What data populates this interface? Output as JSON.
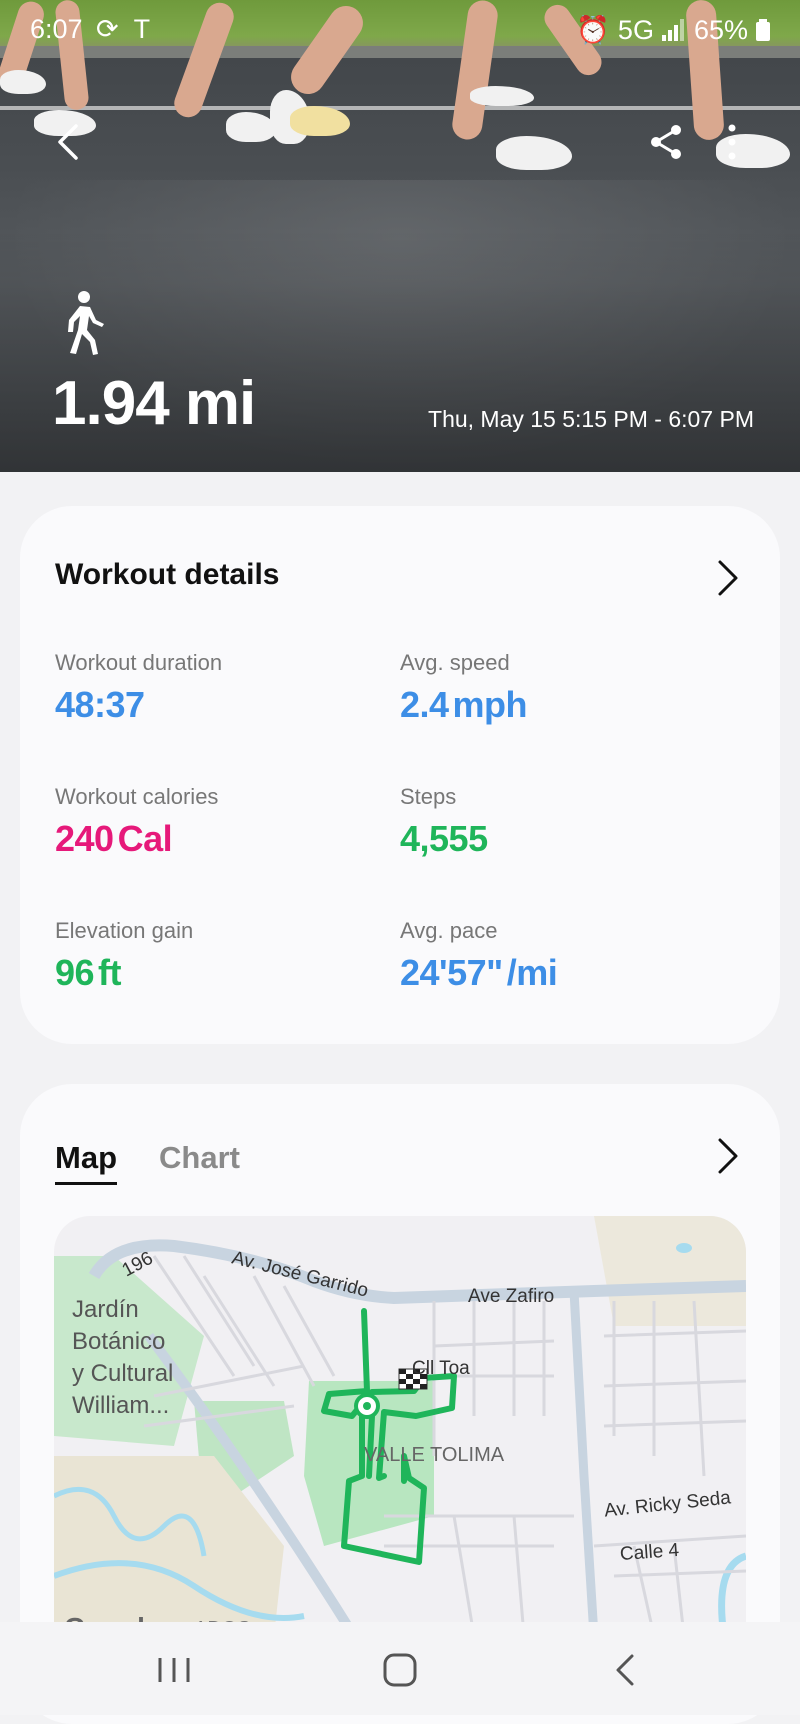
{
  "status": {
    "time": "6:07",
    "network": "5G",
    "battery": "65%"
  },
  "hero": {
    "activity_icon": "walk-icon",
    "distance": "1.94 mi",
    "date_range": "Thu, May 15 5:15 PM - 6:07 PM"
  },
  "details": {
    "title": "Workout details",
    "metrics": [
      {
        "label": "Workout duration",
        "value": "48:37",
        "unit": "",
        "color": "#3d8ee6"
      },
      {
        "label": "Avg. speed",
        "value": "2.4",
        "unit": "mph",
        "color": "#3d8ee6"
      },
      {
        "label": "Workout calories",
        "value": "240",
        "unit": "Cal",
        "color": "#e6197a"
      },
      {
        "label": "Steps",
        "value": "4,555",
        "unit": "",
        "color": "#1fb55a"
      },
      {
        "label": "Elevation gain",
        "value": "96",
        "unit": "ft",
        "color": "#1fb55a"
      },
      {
        "label": "Avg. pace",
        "value": "24'57\"",
        "unit": "/mi",
        "color": "#3d8ee6"
      }
    ]
  },
  "map_card": {
    "tabs": [
      "Map",
      "Chart"
    ],
    "active_tab": "Map",
    "labels": {
      "road_196": "196",
      "jose_garrido": "Av. José Garrido",
      "zafiro": "Ave Zafiro",
      "toa": "Cll Toa",
      "valle_tolima": "VALLE TOLIMA",
      "ricky_seda": "Av. Ricky Seda",
      "calle4": "Calle 4",
      "jardin_1": "Jardín",
      "jardin_2": "Botánico",
      "jardin_3": "y Cultural",
      "jardin_4": "William...",
      "google": "Google",
      "ados": "ADOS"
    },
    "route_color": "#1fb55a"
  }
}
